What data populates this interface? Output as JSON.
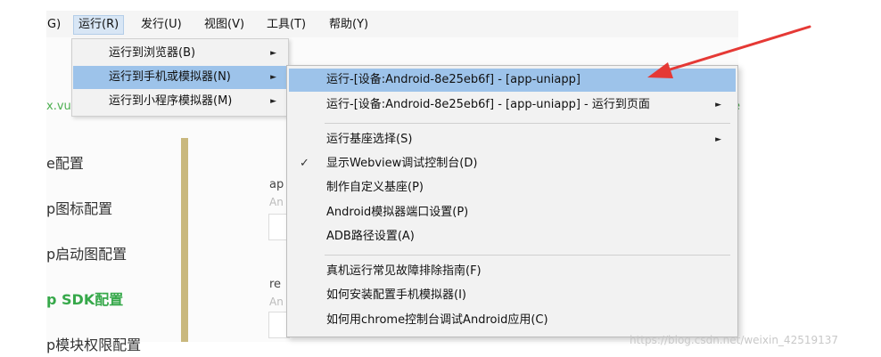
{
  "menubar": {
    "items": [
      {
        "label": "G)"
      },
      {
        "label": "运行(R)"
      },
      {
        "label": "发行(U)"
      },
      {
        "label": "视图(V)"
      },
      {
        "label": "工具(T)"
      },
      {
        "label": "帮助(Y)"
      }
    ]
  },
  "background": {
    "green_left": "x.vu",
    "green_right": "e",
    "settings": [
      "e配置",
      "p图标配置",
      "p启动图配置",
      "p SDK配置",
      "p模块权限配置"
    ],
    "side_labels": [
      "ap",
      "re"
    ],
    "side_hints": [
      "An",
      "An"
    ]
  },
  "run_menu": {
    "items": [
      {
        "label": "运行到浏览器(B)",
        "has_submenu": true
      },
      {
        "label": "运行到手机或模拟器(N)",
        "has_submenu": true
      },
      {
        "label": "运行到小程序模拟器(M)",
        "has_submenu": true
      }
    ]
  },
  "device_menu": {
    "items": [
      {
        "label": "运行-[设备:Android-8e25eb6f] - [app-uniapp]"
      },
      {
        "label": "运行-[设备:Android-8e25eb6f] - [app-uniapp] - 运行到页面",
        "has_submenu": true
      },
      {
        "label": "运行基座选择(S)",
        "has_submenu": true
      },
      {
        "label": "显示Webview调试控制台(D)",
        "checked": true
      },
      {
        "label": "制作自定义基座(P)"
      },
      {
        "label": "Android模拟器端口设置(P)"
      },
      {
        "label": "ADB路径设置(A)"
      },
      {
        "label": "真机运行常见故障排除指南(F)"
      },
      {
        "label": "如何安装配置手机模拟器(I)"
      },
      {
        "label": "如何用chrome控制台调试Android应用(C)"
      }
    ],
    "checkmark": "✓"
  },
  "arrow_glyph": "►",
  "watermark": "https://blog.csdn.net/weixin_42519137",
  "colors": {
    "highlight": "#9dc3ea",
    "annotation_arrow": "#e53935",
    "accent_green": "#36a84a"
  }
}
